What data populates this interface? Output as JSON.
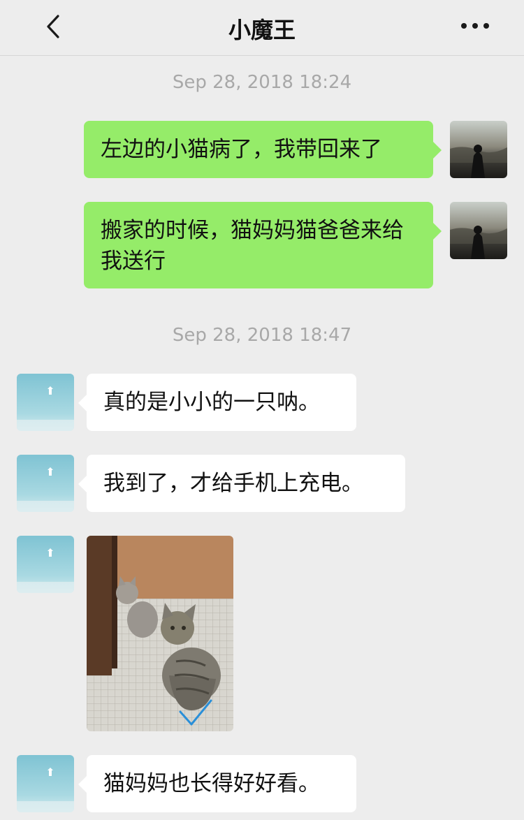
{
  "header": {
    "title": "小魔王",
    "back_icon": "chevron-left-icon",
    "more_icon": "more-dots-icon"
  },
  "messages": [
    {
      "type": "timestamp",
      "text": "Sep 28, 2018 18:24"
    },
    {
      "type": "text",
      "side": "right",
      "text": "左边的小猫病了，我带回来了"
    },
    {
      "type": "text",
      "side": "right",
      "text": "搬家的时候，猫妈妈猫爸爸来给我送行"
    },
    {
      "type": "timestamp",
      "text": "Sep 28, 2018 18:47"
    },
    {
      "type": "text",
      "side": "left",
      "text": "真的是小小的一只呐。"
    },
    {
      "type": "text",
      "side": "left",
      "text": "我到了，才给手机上充电。"
    },
    {
      "type": "image",
      "side": "left",
      "description_icon": "cat-photo"
    },
    {
      "type": "text",
      "side": "left",
      "text": "猫妈妈也长得好好看。"
    }
  ],
  "colors": {
    "background": "#ededed",
    "bubble_self": "#95ec69",
    "bubble_other": "#ffffff",
    "timestamp": "#a8a8a8"
  }
}
